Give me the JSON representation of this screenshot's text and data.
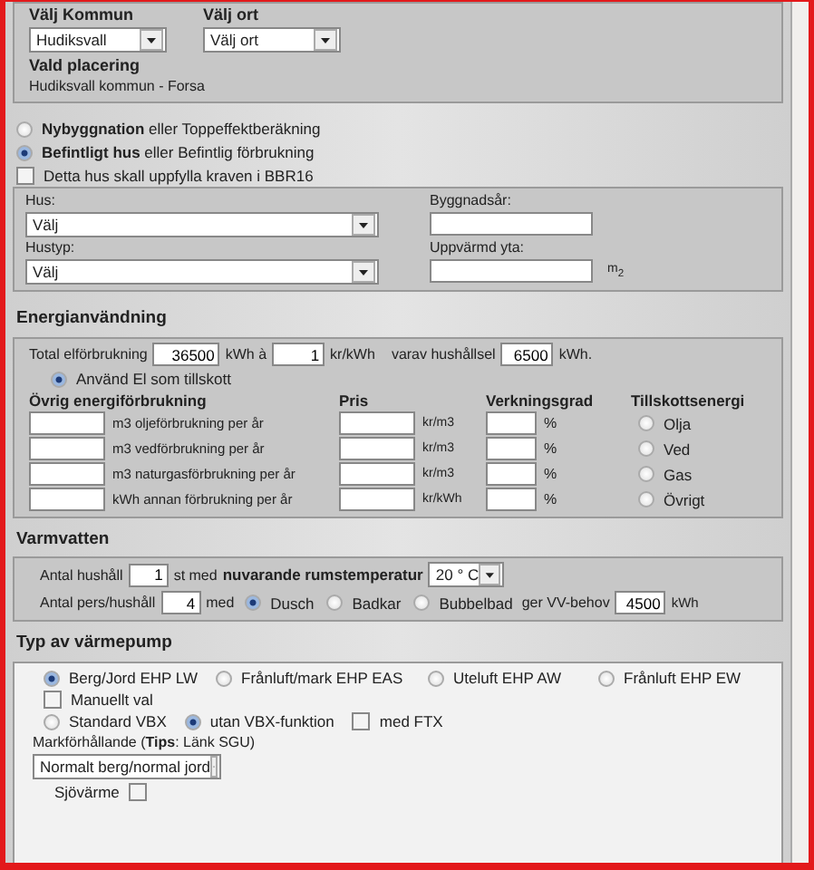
{
  "location": {
    "municipality_label": "Välj Kommun",
    "municipality": "Hudiksvall",
    "place_label": "Välj ort",
    "place": "Välj ort",
    "chosen_label": "Vald placering",
    "chosen": "Hudiksvall kommun - Forsa"
  },
  "calc_mode": [
    {
      "label": "**Nybyggnation** eller Toppeffektberäkning",
      "selected": false
    },
    {
      "label": "**Befintligt hus** eller Befintlig förbrukning",
      "selected": true
    }
  ],
  "bbr16": {
    "label": "Detta hus skall uppfylla kraven i BBR16",
    "checked": false
  },
  "house": [
    {
      "label": "Hus:",
      "kind": "select",
      "value": "Välj"
    },
    {
      "label": "Byggnadsår:",
      "kind": "input"
    },
    {
      "label": "Hustyp:",
      "kind": "select",
      "value": "Välj"
    },
    {
      "label": "Uppvärmd yta:",
      "kind": "input",
      "unit": "m$_{2}$"
    }
  ],
  "energy": {
    "title": "Energianvändning",
    "total_label": "Total elförbrukning",
    "total": "36500",
    "total_unit": "kWh à",
    "price": "1",
    "price_unit": "kr/kWh",
    "household_label": "varav hushållsel",
    "household": "6500",
    "household_unit": "kWh.",
    "supplement": {
      "label": "Använd El som tillskott",
      "selected": true
    },
    "columns": [
      "Övrig energiförbrukning",
      "Pris",
      "Verkningsgrad",
      "Tillskottsenergi"
    ],
    "rows": [
      {
        "unit": "m3 oljeförbrukning per år",
        "price_unit": "kr/m3",
        "efficiency_unit": "%",
        "fuel": "Olja",
        "selected": false
      },
      {
        "unit": "m3 vedförbrukning per år",
        "price_unit": "kr/m3",
        "efficiency_unit": "%",
        "fuel": "Ved",
        "selected": false
      },
      {
        "unit": "m3 naturgasförbrukning per år",
        "price_unit": "kr/m3",
        "efficiency_unit": "%",
        "fuel": "Gas",
        "selected": false
      },
      {
        "unit": "kWh annan förbrukning per år",
        "price_unit": "kr/kWh",
        "efficiency_unit": "%",
        "fuel": "Övrigt",
        "selected": false
      }
    ]
  },
  "hot_water": {
    "title": "Varmvatten",
    "households_label": "Antal hushåll",
    "households": "1",
    "households_unit": "st med",
    "temp_label": "nuvarande rumstemperatur",
    "temp": "20 ° C",
    "persons_label": "Antal pers/hushåll",
    "persons": "4",
    "persons_unit": "med",
    "bath_options": [
      {
        "label": "Dusch",
        "selected": true
      },
      {
        "label": "Badkar",
        "selected": false
      },
      {
        "label": "Bubbelbad",
        "selected": false
      }
    ],
    "need_label": "ger VV-behov",
    "need": "4500",
    "need_unit": "kWh"
  },
  "heat_pump": {
    "title": "Typ av värmepump",
    "types": [
      {
        "label": "Berg/Jord EHP LW",
        "selected": true
      },
      {
        "label": "Frånluft/mark EHP EAS",
        "selected": false
      },
      {
        "label": "Uteluft EHP AW",
        "selected": false
      },
      {
        "label": "Frånluft EHP EW",
        "selected": false
      }
    ],
    "manual": {
      "label": "Manuellt val",
      "checked": false
    },
    "vbx_options": [
      {
        "label": "Standard VBX",
        "selected": false
      },
      {
        "label": "utan VBX-funktion",
        "selected": true
      }
    ],
    "ftx": {
      "label": "med FTX",
      "checked": false
    },
    "ground_label": "Markförhållande (**Tips**: Länk SGU)",
    "ground": "Normalt berg/normal jord",
    "lake": {
      "label": "Sjövärme",
      "checked": false
    }
  }
}
